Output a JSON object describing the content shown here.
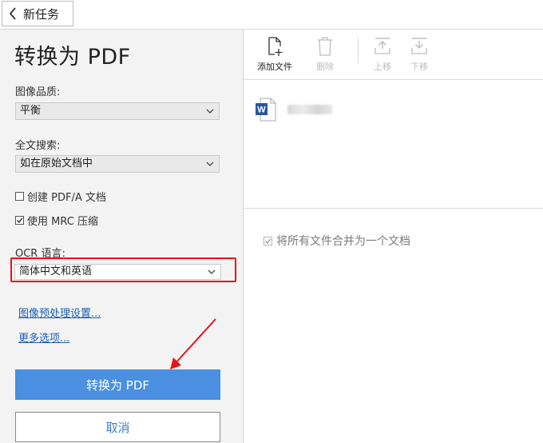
{
  "header": {
    "back_label": "新任务"
  },
  "panel": {
    "title": "转换为 PDF",
    "image_quality": {
      "label": "图像品质:",
      "value": "平衡"
    },
    "full_text_search": {
      "label": "全文搜索:",
      "value": "如在原始文档中"
    },
    "checkboxes": [
      {
        "label": "创建 PDF/A 文档",
        "checked": false
      },
      {
        "label": "使用 MRC 压缩",
        "checked": true
      }
    ],
    "ocr_language": {
      "label": "OCR 语言:",
      "value": "简体中文和英语"
    },
    "links": {
      "image_preprocess": "图像预处理设置...",
      "more_options": "更多选项..."
    },
    "buttons": {
      "convert": "转换为 PDF",
      "cancel": "取消"
    }
  },
  "toolbar": {
    "add_file": "添加文件",
    "delete": "删除",
    "move_up": "上移",
    "move_down": "下移"
  },
  "files": [
    {
      "icon": "word-doc-icon"
    }
  ],
  "merge": {
    "label": "将所有文件合并为一个文档",
    "checked": true
  },
  "colors": {
    "primary": "#4a8fe0",
    "highlight_red": "#e3141b",
    "link": "#1a5fb4",
    "word_blue": "#2b579a"
  }
}
